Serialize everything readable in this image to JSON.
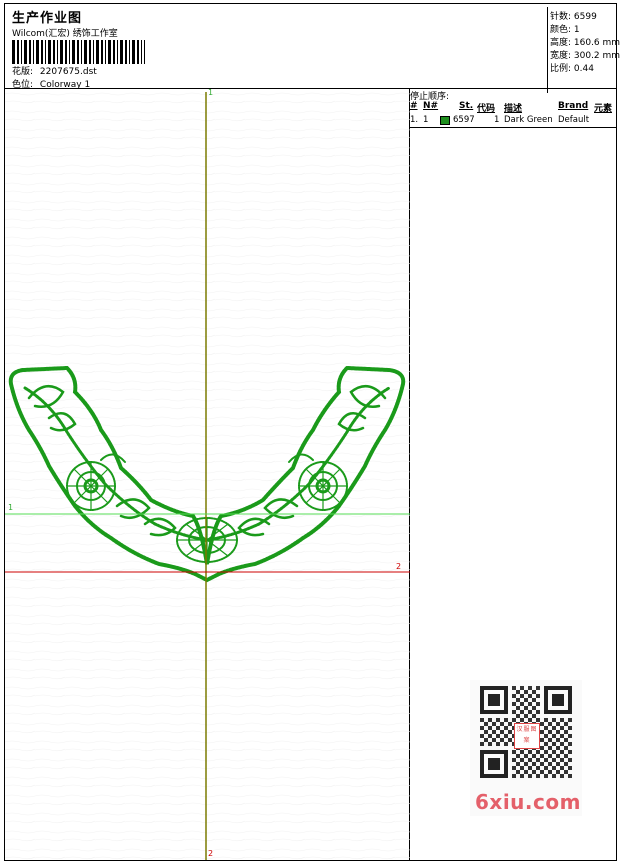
{
  "header": {
    "title": "生产作业图",
    "studio": "Wilcom(汇宏) 绣饰工作室",
    "pattern_label": "花版:",
    "pattern_value": "2207675.dst",
    "colorway_label": "色位:",
    "colorway_value": "Colorway 1"
  },
  "info": {
    "stitches": "针数: 6599",
    "colors": "颜色: 1",
    "height": "高度: 160.6 mm",
    "width": "宽度: 300.2 mm",
    "scale": "比例: 0.44"
  },
  "stop_sequence": {
    "title": "停止顺序:",
    "columns": [
      "#",
      "N#",
      "St.",
      "代码",
      "描述",
      "Brand",
      "元素"
    ],
    "rows": [
      {
        "index": "1.",
        "needle": "1",
        "color": "#1f8f1f",
        "stitches": "6597",
        "code": "1",
        "description": "Dark Green",
        "brand": "Default",
        "element": ""
      }
    ]
  },
  "guides": {
    "v_top": "1",
    "v_bottom": "2",
    "h_green": "1",
    "h_red": "2",
    "colors": {
      "vertical": "#7b7b00",
      "green": "#55dd55",
      "red": "#cc0000"
    }
  },
  "design": {
    "thread_color": "#1a9a1a"
  },
  "watermark": {
    "text": "6xiu.com",
    "badge": "汉服图案"
  }
}
